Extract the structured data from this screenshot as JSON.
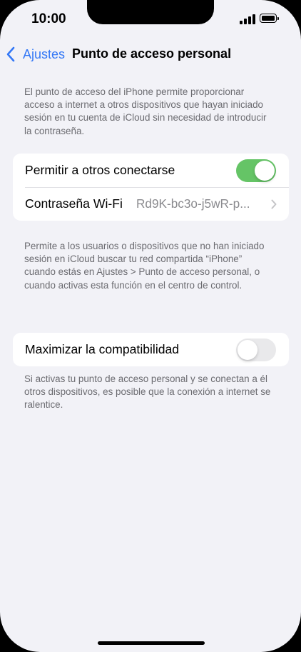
{
  "status_bar": {
    "time": "10:00"
  },
  "nav": {
    "back_label": "Ajustes",
    "title": "Punto de acceso personal"
  },
  "intro_text": "El punto de acceso del iPhone permite proporcionar acceso a internet a otros dispositivos que hayan iniciado sesión en tu cuenta de iCloud sin necesidad de introducir la contraseña.",
  "group1": {
    "allow_others_label": "Permitir a otros conectarse",
    "allow_others_on": true,
    "wifi_password_label": "Contraseña Wi-Fi",
    "wifi_password_value": "Rd9K-bc3o-j5wR-p..."
  },
  "group1_footer": "Permite a los usuarios o dispositivos que no han iniciado sesión en iCloud buscar tu red compartida “iPhone” cuando estás en Ajustes > Punto de acceso personal, o cuando activas esta función en el centro de control.",
  "group2": {
    "max_compat_label": "Maximizar la compatibilidad",
    "max_compat_on": false
  },
  "group2_footer": "Si activas tu punto de acceso personal y se conectan a él otros dispositivos, es posible que la conexión a internet se ralentice.",
  "colors": {
    "accent": "#3478f6",
    "toggle_on": "#65c466",
    "toggle_off": "#e9e9eb"
  },
  "icons": [
    "back-chevron-icon",
    "chevron-right-icon",
    "signal-icon",
    "battery-icon"
  ]
}
